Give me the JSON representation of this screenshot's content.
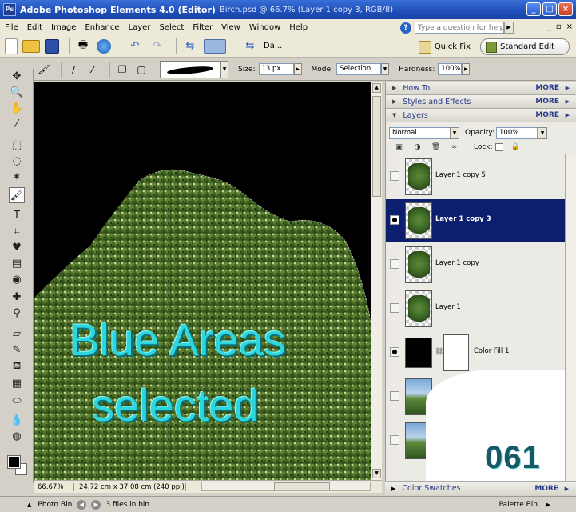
{
  "title": {
    "app": "Adobe Photoshop Elements 4.0 (Editor)",
    "doc": "Birch.psd @ 66.7% (Layer 1 copy 3, RGB/8)",
    "icon_name": "photoshop-elements-icon",
    "controls": {
      "minimize": "_",
      "maximize": "□",
      "close": "×"
    }
  },
  "menubar": {
    "items": [
      "File",
      "Edit",
      "Image",
      "Enhance",
      "Layer",
      "Select",
      "Filter",
      "View",
      "Window",
      "Help"
    ],
    "help_placeholder": "Type a question for help",
    "window_controls": {
      "minimize": "_",
      "restore": "▫",
      "close": "×"
    }
  },
  "shortcuts": {
    "date_view_label": "Da...",
    "quick_fix": "Quick Fix",
    "standard_edit": "Standard Edit"
  },
  "options": {
    "size_label": "Size:",
    "size_value": "13 px",
    "mode_label": "Mode:",
    "mode_value": "Selection",
    "hardness_label": "Hardness:",
    "hardness_value": "100%"
  },
  "canvas": {
    "overlay_line1": "Blue Areas",
    "overlay_line2": "selected",
    "overlay_color": "#2cd6dc"
  },
  "status": {
    "zoom": "66.67%",
    "dimensions": "24.72 cm x 37.08 cm (240 ppi)"
  },
  "palettes": {
    "how_to": "How To",
    "styles": "Styles and Effects",
    "layers": "Layers",
    "color_swatches": "Color Swatches",
    "more": "MORE"
  },
  "layers_panel": {
    "blend_mode": "Normal",
    "opacity_label": "Opacity:",
    "opacity_value": "100%",
    "lock_label": "Lock:",
    "layers": [
      {
        "name": "Layer 1 copy 5",
        "visible": false,
        "selected": false
      },
      {
        "name": "Layer 1 copy 3",
        "visible": true,
        "selected": true
      },
      {
        "name": "Layer 1 copy",
        "visible": false,
        "selected": false
      },
      {
        "name": "Layer 1",
        "visible": false,
        "selected": false
      },
      {
        "name": "Color Fill 1",
        "visible": true,
        "selected": false
      }
    ],
    "selected_color": "#0c1f6e",
    "eye_glyph": "●"
  },
  "badge": "061",
  "binbar": {
    "photo_bin": "Photo Bin",
    "files_in_bin": "3 files in bin",
    "palette_bin": "Palette Bin"
  }
}
